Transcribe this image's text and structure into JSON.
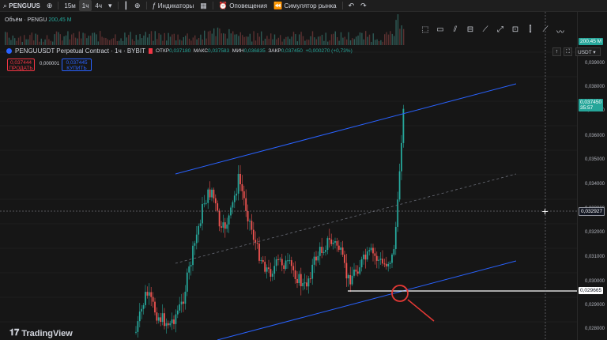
{
  "topbar": {
    "symbol": "PENGUUS",
    "intervals": [
      "15м",
      "1ч",
      "4ч"
    ],
    "active_interval": "1ч",
    "indicators_label": "Индикаторы",
    "alerts_label": "Оповещения",
    "simulator_label": "Симулятор рынка"
  },
  "volume": {
    "label": "Объём · PENGU",
    "value": "200,45 M",
    "axis_tag": "200,45 M"
  },
  "legend": {
    "title": "PENGUUSDT Perpetual Contract · 1ч · BYBIT",
    "open_label": "ОТКР",
    "open": "0,037180",
    "high_label": "МАКС",
    "high": "0,037583",
    "low_label": "МИН",
    "low": "0,036835",
    "close_label": "ЗАКР",
    "close": "0,037450",
    "change": "+0,000270 (+0,73%)"
  },
  "trade": {
    "sell_price": "0,037444",
    "sell_label": "ПРОДАТЬ",
    "spread": "0,000001",
    "buy_price": "0,037445",
    "buy_label": "КУПИТЬ"
  },
  "axis": {
    "currency": "USDT",
    "ticks": [
      "0,039000",
      "0,038000",
      "0,037000",
      "0,036000",
      "0,035000",
      "0,034000",
      "0,033000",
      "0,032000",
      "0,031000",
      "0,030000",
      "0,029000",
      "0,028000"
    ],
    "last_price": "0,037450",
    "countdown": "35:57",
    "crosshair_price": "0,032927",
    "hline_price": "0,029665"
  },
  "branding": {
    "name": "TradingView"
  },
  "colors": {
    "up": "#26a69a",
    "down": "#ef5350",
    "channel": "#2962ff",
    "annotation": "#e53935"
  },
  "icons": [
    "search-icon",
    "add-symbol-icon",
    "chevron-down-icon",
    "compare-icon",
    "indicators-icon",
    "layout-icon",
    "alert-icon",
    "replay-icon",
    "undo-icon",
    "redo-icon"
  ]
}
